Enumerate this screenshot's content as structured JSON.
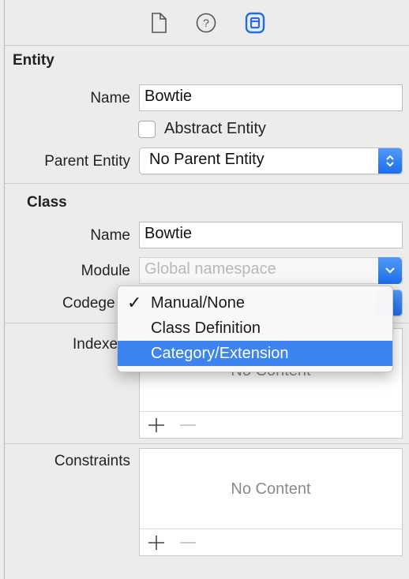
{
  "inspector": {
    "tabs": [
      {
        "name": "file-inspector",
        "icon": "document-icon"
      },
      {
        "name": "quick-help",
        "icon": "question-icon"
      },
      {
        "name": "data-model-inspector",
        "icon": "data-model-icon",
        "active": true
      }
    ],
    "accent_color": "#1e6ee8"
  },
  "entity": {
    "section_title": "Entity",
    "name_label": "Name",
    "name_value": "Bowtie",
    "abstract_label": "Abstract Entity",
    "abstract_checked": false,
    "parent_label": "Parent Entity",
    "parent_value": "No Parent Entity"
  },
  "class": {
    "section_title": "Class",
    "name_label": "Name",
    "name_value": "Bowtie",
    "module_label": "Module",
    "module_placeholder": "Global namespace",
    "codegen_label": "Codege"
  },
  "codegen_menu": {
    "items": [
      {
        "label": "Manual/None",
        "checked": true,
        "highlighted": false
      },
      {
        "label": "Class Definition",
        "checked": false,
        "highlighted": false
      },
      {
        "label": "Category/Extension",
        "checked": false,
        "highlighted": true
      }
    ]
  },
  "indexes": {
    "label": "Indexe",
    "empty_text": "No Content"
  },
  "constraints": {
    "label": "Constraints",
    "empty_text": "No Content"
  }
}
